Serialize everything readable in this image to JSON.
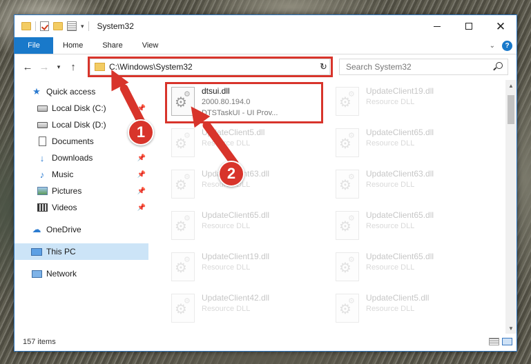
{
  "window": {
    "title": "System32",
    "minimize_glyph": "",
    "close_glyph": "✕"
  },
  "ribbon": {
    "tabs": [
      "File",
      "Home",
      "Share",
      "View"
    ],
    "help": "?"
  },
  "nav": {
    "back": "←",
    "forward": "→",
    "recent": "▾",
    "up": "↑",
    "address": "C:\\Windows\\System32",
    "refresh": "↻",
    "search_placeholder": "Search System32"
  },
  "sidebar": {
    "items": [
      {
        "label": "Quick access",
        "icon": "star-icon",
        "level": 0,
        "pinned": false
      },
      {
        "label": "Local Disk (C:)",
        "icon": "drive-icon",
        "level": 1,
        "pinned": true
      },
      {
        "label": "Local Disk (D:)",
        "icon": "drive-icon",
        "level": 1,
        "pinned": false
      },
      {
        "label": "Documents",
        "icon": "documents-icon",
        "level": 1,
        "pinned": false
      },
      {
        "label": "Downloads",
        "icon": "downloads-icon",
        "level": 1,
        "pinned": true
      },
      {
        "label": "Music",
        "icon": "music-icon",
        "level": 1,
        "pinned": true
      },
      {
        "label": "Pictures",
        "icon": "pictures-icon",
        "level": 1,
        "pinned": true
      },
      {
        "label": "Videos",
        "icon": "videos-icon",
        "level": 1,
        "pinned": true
      },
      {
        "label": "OneDrive",
        "icon": "onedrive-icon",
        "level": 0,
        "pinned": false
      },
      {
        "label": "This PC",
        "icon": "this-pc-icon",
        "level": 0,
        "pinned": false,
        "selected": true
      },
      {
        "label": "Network",
        "icon": "network-icon",
        "level": 0,
        "pinned": false
      }
    ]
  },
  "files": [
    {
      "name": "dtsui.dll",
      "line2": "2000.80.194.0",
      "line3": "DTSTaskUI - UI Prov...",
      "highlighted": true
    },
    {
      "name": "UpdateClient19.dll",
      "line2": "Resource DLL",
      "line3": ""
    },
    {
      "name": "UpdateClient5.dll",
      "line2": "Resource DLL",
      "line3": ""
    },
    {
      "name": "UpdateClient65.dll",
      "line2": "Resource DLL",
      "line3": ""
    },
    {
      "name": "UpdateClient63.dll",
      "line2": "Resource DLL",
      "line3": ""
    },
    {
      "name": "UpdateClient63.dll",
      "line2": "Resource DLL",
      "line3": ""
    },
    {
      "name": "UpdateClient65.dll",
      "line2": "Resource DLL",
      "line3": ""
    },
    {
      "name": "UpdateClient65.dll",
      "line2": "Resource DLL",
      "line3": ""
    },
    {
      "name": "UpdateClient19.dll",
      "line2": "Resource DLL",
      "line3": ""
    },
    {
      "name": "UpdateClient65.dll",
      "line2": "Resource DLL",
      "line3": ""
    },
    {
      "name": "UpdateClient42.dll",
      "line2": "Resource DLL",
      "line3": ""
    },
    {
      "name": "UpdateClient5.dll",
      "line2": "Resource DLL",
      "line3": ""
    }
  ],
  "status": {
    "item_count": "157 items"
  },
  "callouts": [
    "1",
    "2"
  ],
  "colors": {
    "accent": "#1979ca",
    "highlight": "#d8342b",
    "selected": "#cce4f7"
  }
}
